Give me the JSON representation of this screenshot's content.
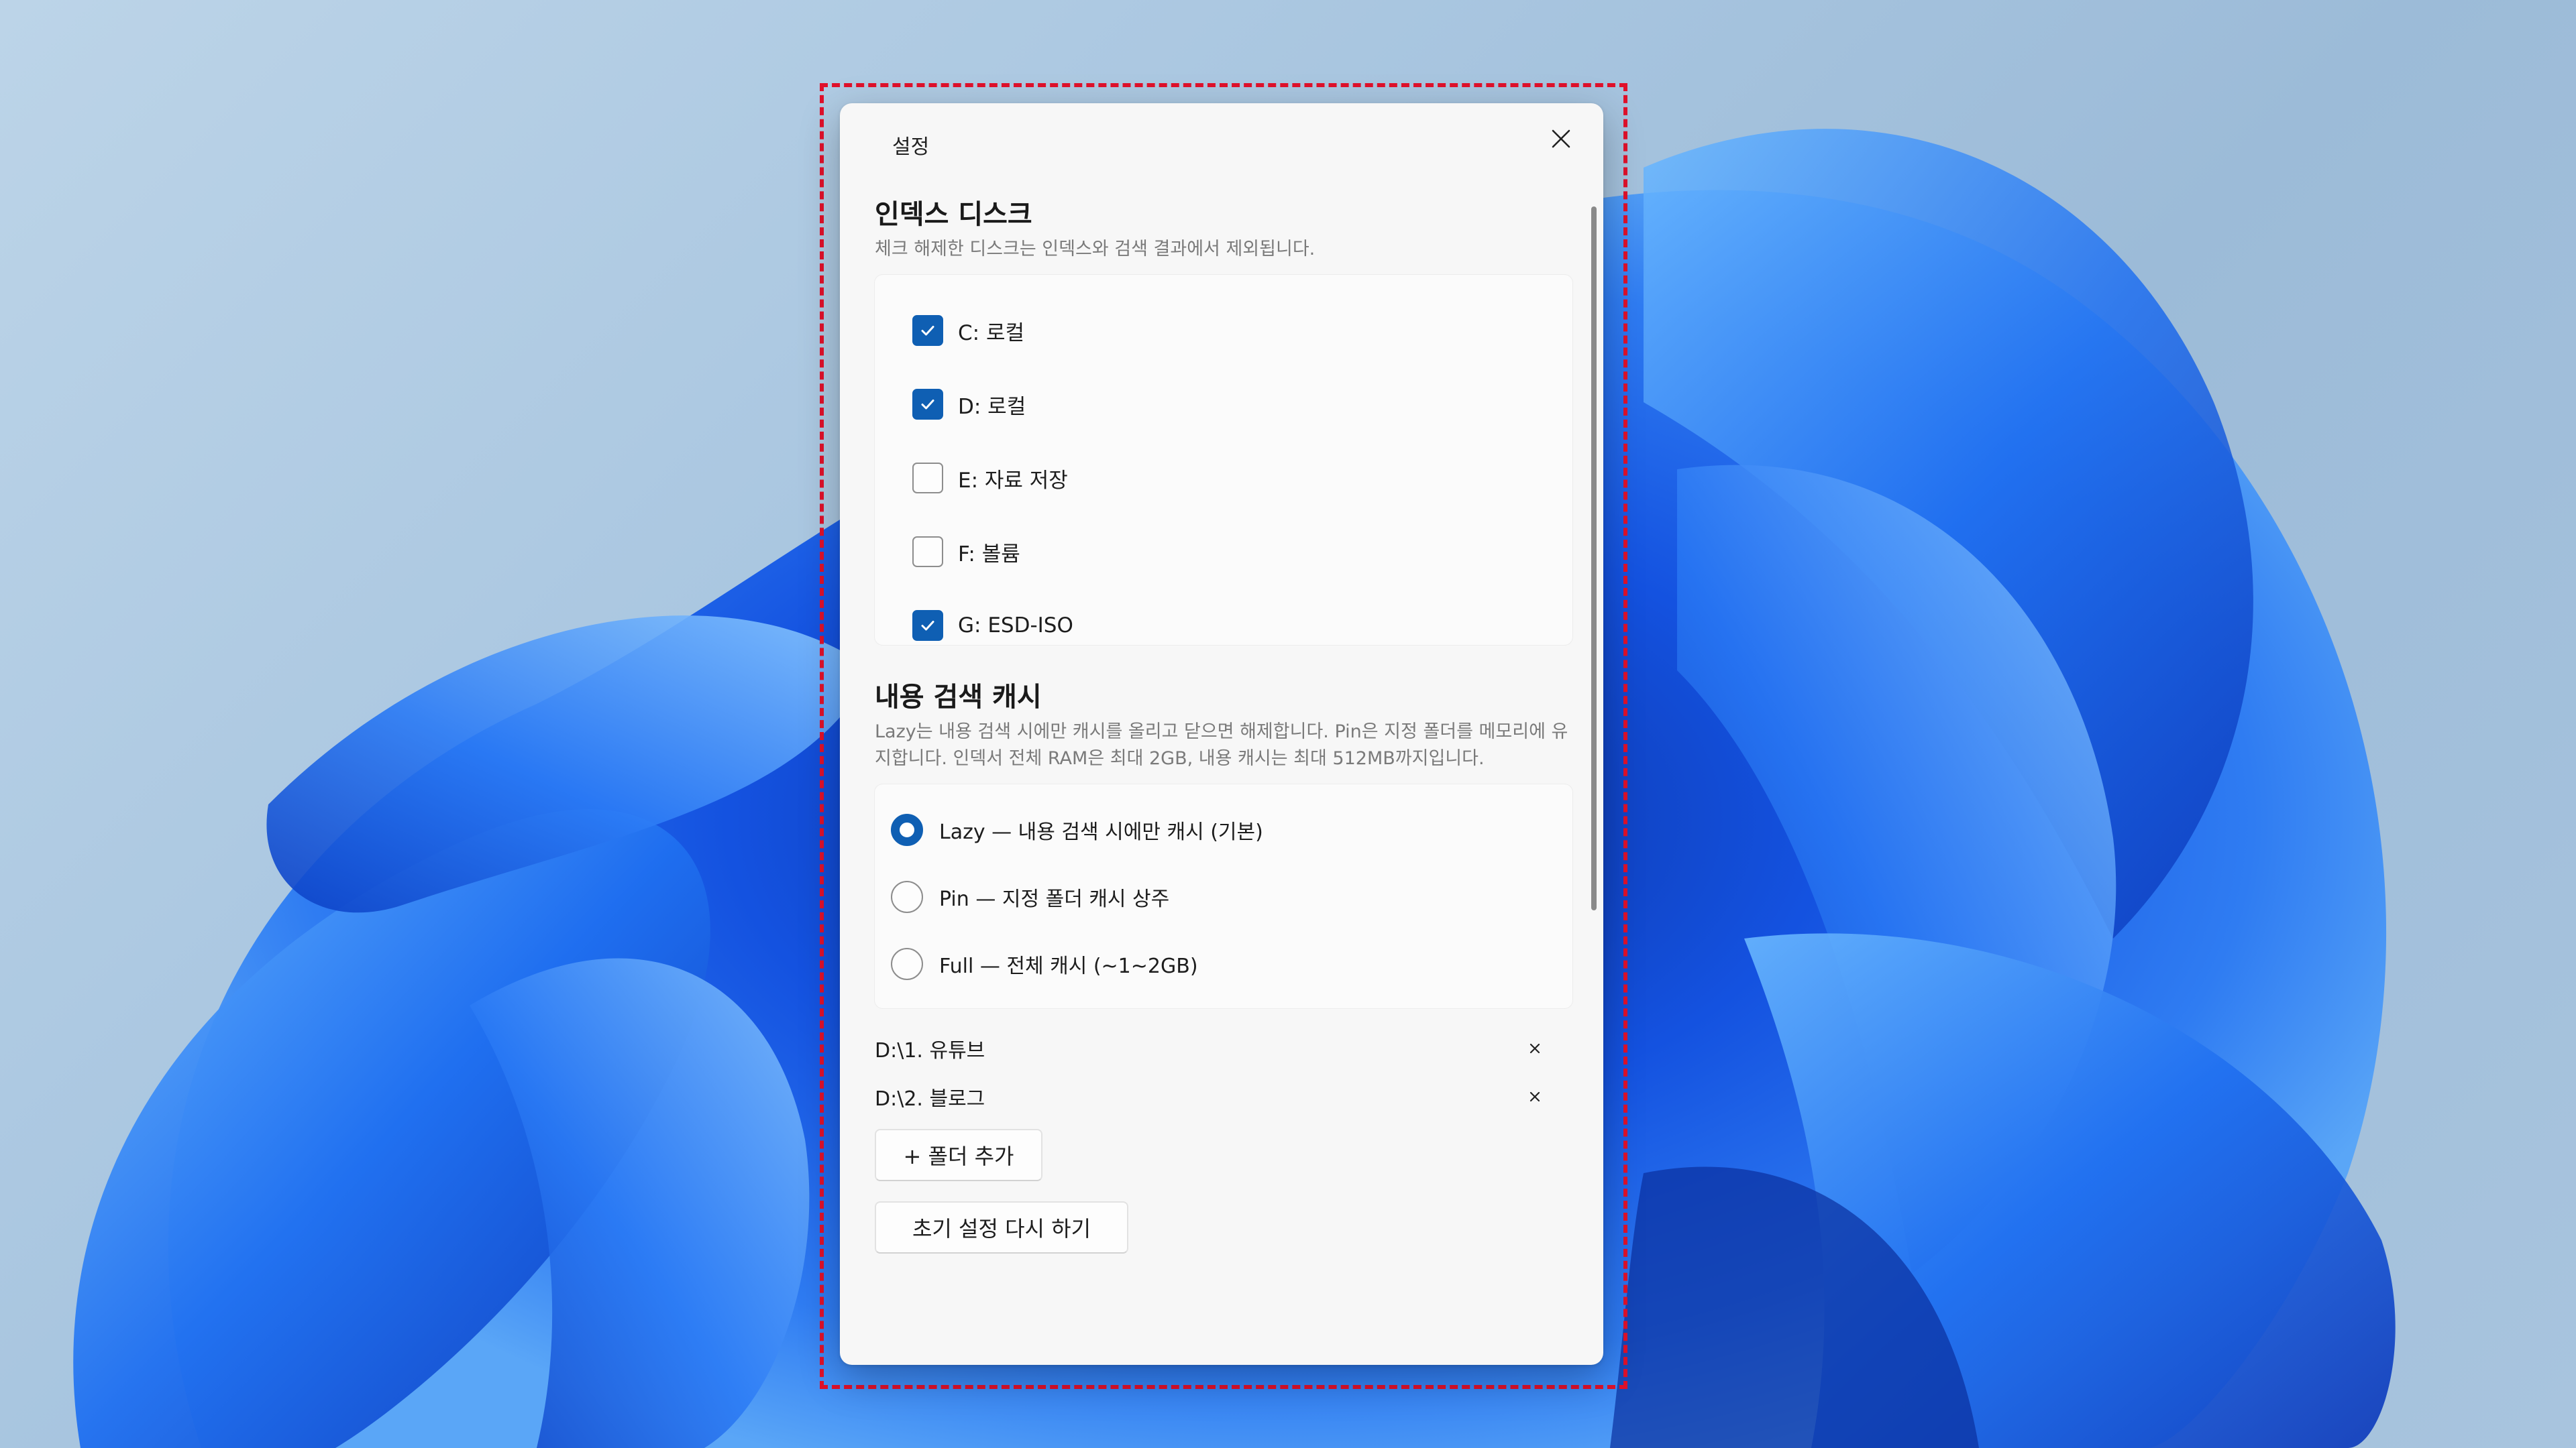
{
  "dialog": {
    "title": "설정",
    "close_icon": "close-icon"
  },
  "index_disks": {
    "title": "인덱스 디스크",
    "description": "체크 해제한 디스크는 인덱스와 검색 결과에서 제외됩니다.",
    "items": [
      {
        "label": "C:  로컬",
        "checked": true
      },
      {
        "label": "D:  로컬",
        "checked": true
      },
      {
        "label": "E:  자료 저장",
        "checked": false
      },
      {
        "label": "F:  볼륨",
        "checked": false
      },
      {
        "label": "G:  ESD-ISO",
        "checked": true
      }
    ]
  },
  "content_cache": {
    "title": "내용 검색 캐시",
    "description": "Lazy는 내용 검색 시에만 캐시를 올리고 닫으면 해제합니다. Pin은 지정 폴더를 메모리에 유지합니다. 인덱서 전체 RAM은 최대 2GB, 내용 캐시는 최대 512MB까지입니다.",
    "options": [
      {
        "label": "Lazy — 내용 검색 시에만 캐시 (기본)",
        "selected": true
      },
      {
        "label": "Pin — 지정 폴더 캐시 상주",
        "selected": false
      },
      {
        "label": "Full — 전체 캐시 (~1~2GB)",
        "selected": false
      }
    ],
    "pinned_folders": [
      {
        "path": "D:\\1. 유튜브"
      },
      {
        "path": "D:\\2. 블로그"
      }
    ],
    "add_folder_label": "+ 폴더 추가"
  },
  "reset_label": "초기 설정 다시 하기",
  "colors": {
    "accent": "#0f5fb3",
    "highlight": "#e0112b"
  }
}
